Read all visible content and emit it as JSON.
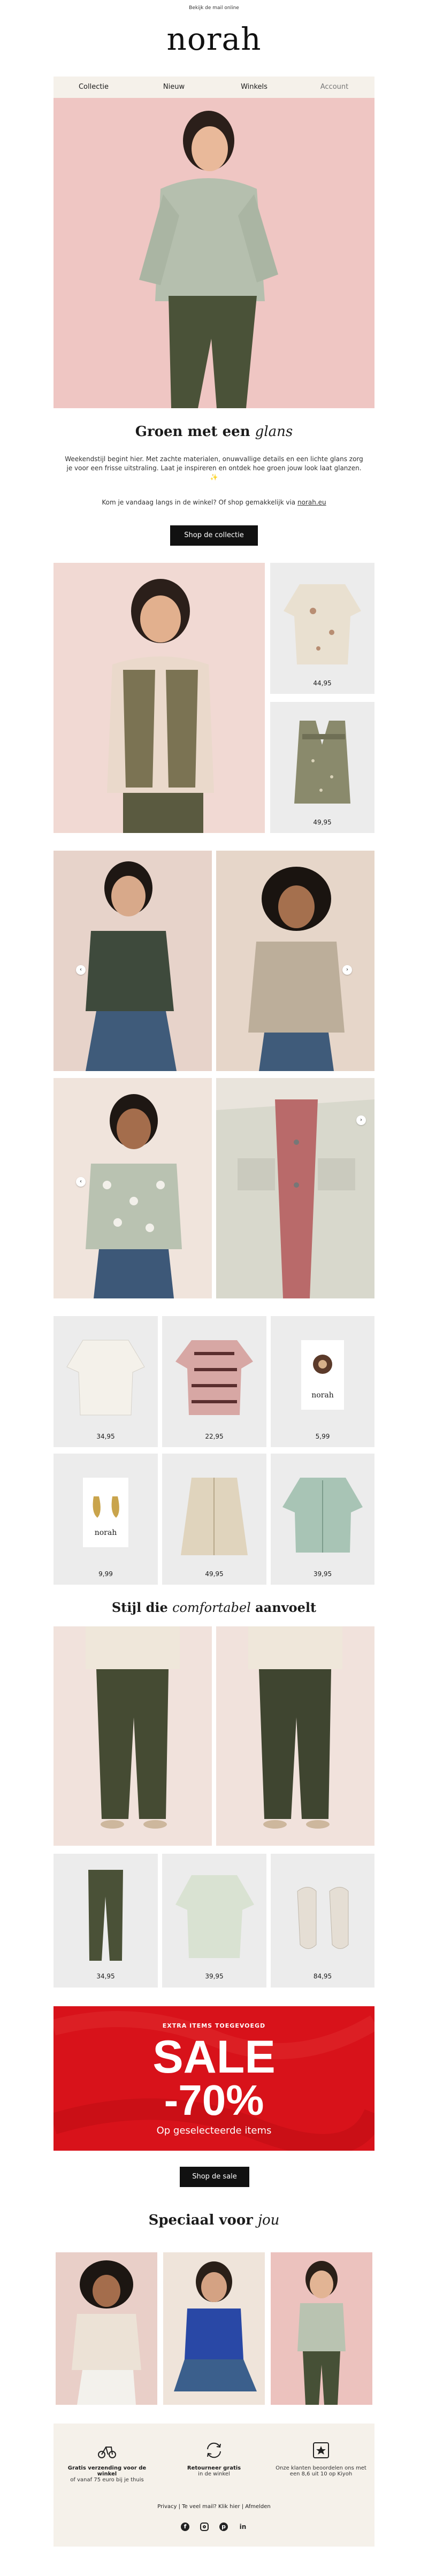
{
  "preheader": "Bekijk de mail online",
  "brand": "norah",
  "nav": [
    "Collectie",
    "Nieuw",
    "Winkels",
    "Account"
  ],
  "hero": {
    "title_plain": "Groen met een",
    "title_italic": "glans",
    "body": "Weekendstijl begint hier. Met zachte materialen, onuwvallige details en een lichte glans zorg je voor een frisse uitstraling. Laat je inspireren en ontdek hoe groen jouw look laat glanzen. ✨",
    "visit_text": "Kom je vandaag langs in de winkel? Of shop gemakkelijk via",
    "visit_link": "norah.eu",
    "cta": "Shop de collectie"
  },
  "products_top": [
    {
      "price": "44,95"
    },
    {
      "price": "49,95"
    }
  ],
  "products_grid": [
    {
      "price": "34,95"
    },
    {
      "price": "22,95"
    },
    {
      "price": "5,99"
    },
    {
      "price": "9,99"
    },
    {
      "price": "49,95"
    },
    {
      "price": "39,95"
    }
  ],
  "product_tag_brand": "norah",
  "section2": {
    "title_plain_1": "Stijl die",
    "title_italic": "comfortabel",
    "title_plain_2": "aanvoelt"
  },
  "products_comfort": [
    {
      "price": "34,95"
    },
    {
      "price": "39,95"
    },
    {
      "price": "84,95"
    }
  ],
  "sale": {
    "kicker": "EXTRA ITEMS TOEGEVOEGD",
    "headline": "SALE",
    "percent": "-70%",
    "sub": "Op geselecteerde items",
    "cta": "Shop de sale",
    "color": "#d8121a"
  },
  "special": {
    "title_plain": "Speciaal voor",
    "title_italic": "jou"
  },
  "usps": [
    {
      "icon": "delivery-bike-icon",
      "line1": "Gratis verzending voor de winkel",
      "line2": "of vanaf 75 euro bij je thuis"
    },
    {
      "icon": "return-arrows-icon",
      "line1": "Retourneer gratis",
      "line2": "in de winkel"
    },
    {
      "icon": "star-badge-icon",
      "line1": "Onze klanten beoordelen ons met",
      "line2": "een 8,6 uit 10 op Kiyoh"
    }
  ],
  "footer_links": [
    "Privacy",
    "Te veel mail? Klik hier",
    "Afmelden"
  ],
  "social": [
    "facebook-icon",
    "instagram-icon",
    "pinterest-icon",
    "linkedin-icon"
  ]
}
